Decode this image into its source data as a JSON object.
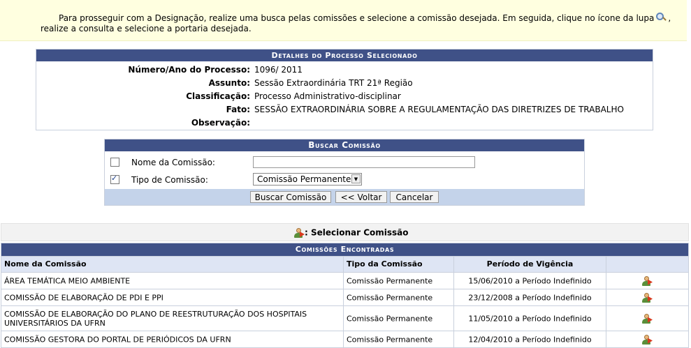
{
  "info": {
    "line1": "Para prosseguir com a Designação, realize uma busca pelas comissões e selecione a comissão desejada. Em seguida, clique no ícone da lupa",
    "line1_tail": ",",
    "line2": "realize a consulta e selecione a portaria desejada."
  },
  "detalhes": {
    "title": "Detalhes do Processo Selecionado",
    "rows": [
      {
        "label": "Número/Ano do Processo:",
        "value": "1096/ 2011"
      },
      {
        "label": "Assunto:",
        "value": "Sessão Extraordinária TRT 21ª Região"
      },
      {
        "label": "Classificação:",
        "value": "Processo Administrativo-disciplinar"
      },
      {
        "label": "Fato:",
        "value": "SESSÃO EXTRAORDINÁRIA SOBRE A REGULAMENTAÇÃO DAS DIRETRIZES DE TRABALHO"
      },
      {
        "label": "Observação:",
        "value": ""
      }
    ]
  },
  "busca": {
    "title": "Buscar Comissão",
    "nome_label": "Nome da Comissão:",
    "nome_value": "",
    "tipo_label": "Tipo de Comissão:",
    "tipo_selected": "Comissão Permanente",
    "nome_checked": false,
    "tipo_checked": true,
    "btn_buscar": "Buscar Comissão",
    "btn_voltar": "<< Voltar",
    "btn_cancelar": "Cancelar"
  },
  "legenda": {
    "text": ": Selecionar Comissão"
  },
  "resultados": {
    "title": "Comissões Encontradas",
    "headers": [
      "Nome da Comissão",
      "Tipo da Comissão",
      "Período de Vigência",
      ""
    ],
    "rows": [
      {
        "nome": "ÁREA TEMÁTICA MEIO AMBIENTE",
        "tipo": "Comissão Permanente",
        "periodo": "15/06/2010 a Período Indefinido"
      },
      {
        "nome": "COMISSÃO DE ELABORAÇÃO DE PDI E PPI",
        "tipo": "Comissão Permanente",
        "periodo": "23/12/2008 a Período Indefinido"
      },
      {
        "nome": "COMISSÃO DE ELABORAÇÃO DO PLANO DE REESTRUTURAÇÃO DOS HOSPITAIS UNIVERSITÁRIOS DA UFRN",
        "tipo": "Comissão Permanente",
        "periodo": "11/05/2010 a Período Indefinido"
      },
      {
        "nome": "COMISSÃO GESTORA DO PORTAL DE PERIÓDICOS DA UFRN",
        "tipo": "Comissão Permanente",
        "periodo": "12/04/2010 a Período Indefinido"
      }
    ]
  }
}
